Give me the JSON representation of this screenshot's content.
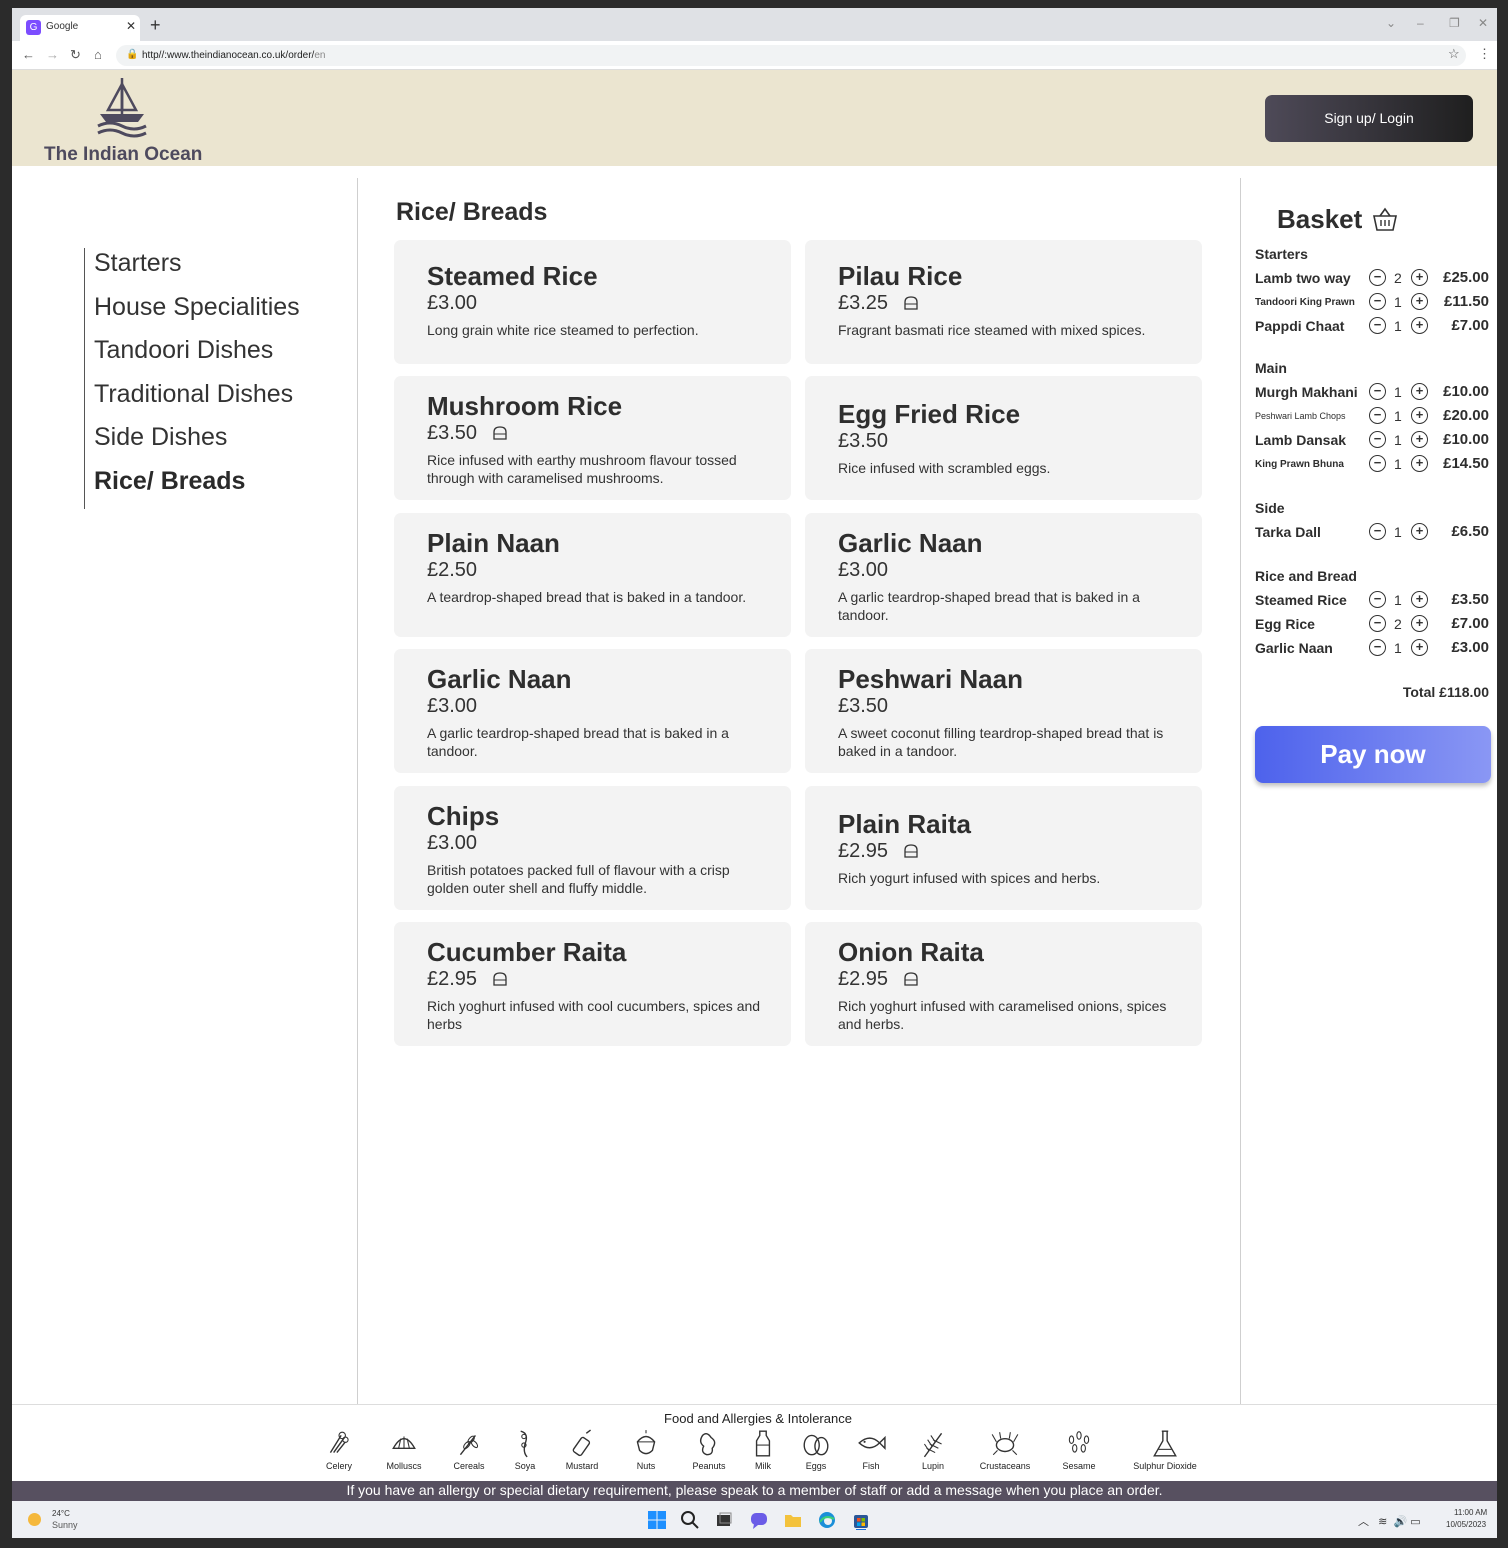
{
  "browser": {
    "tab_title": "Google",
    "url_main": "http//:www.theindianocean.co.uk/order/",
    "url_dim": "en"
  },
  "header": {
    "logo_text": "The Indian Ocean",
    "login_label": "Sign up/ Login"
  },
  "categories": [
    {
      "label": "Starters"
    },
    {
      "label": "House Specialities"
    },
    {
      "label": "Tandoori Dishes"
    },
    {
      "label": "Traditional Dishes"
    },
    {
      "label": "Side Dishes"
    },
    {
      "label": "Rice/ Breads",
      "active": true
    }
  ],
  "section_title": "Rice/ Breads",
  "menu_items": [
    {
      "name": "Steamed Rice",
      "price": "£3.00",
      "desc": "Long grain white rice steamed to perfection.",
      "allergen": false
    },
    {
      "name": "Pilau Rice",
      "price": "£3.25",
      "desc": "Fragrant basmati rice steamed with mixed spices.",
      "allergen": true
    },
    {
      "name": "Mushroom Rice",
      "price": "£3.50",
      "desc": "Rice infused with earthy mushroom flavour tossed through with caramelised mushrooms.",
      "allergen": true
    },
    {
      "name": "Egg Fried Rice",
      "price": "£3.50",
      "desc": "Rice infused with scrambled eggs.",
      "allergen": false
    },
    {
      "name": "Plain Naan",
      "price": "£2.50",
      "desc": "A teardrop-shaped bread that is baked in a tandoor.",
      "allergen": false
    },
    {
      "name": "Garlic Naan",
      "price": "£3.00",
      "desc": "A garlic teardrop-shaped bread that is baked in a tandoor.",
      "allergen": false
    },
    {
      "name": "Garlic Naan",
      "price": "£3.00",
      "desc": "A garlic teardrop-shaped bread that is baked in a tandoor.",
      "allergen": false
    },
    {
      "name": "Peshwari Naan",
      "price": "£3.50",
      "desc": "A sweet coconut filling teardrop-shaped bread that is baked in a tandoor.",
      "allergen": false
    },
    {
      "name": "Chips",
      "price": "£3.00",
      "desc": "British potatoes packed full of flavour with a crisp golden outer shell and fluffy middle.",
      "allergen": false
    },
    {
      "name": "Plain Raita",
      "price": "£2.95",
      "desc": " Rich yogurt infused with spices and herbs.",
      "allergen": true
    },
    {
      "name": "Cucumber Raita",
      "price": "£2.95",
      "desc": "Rich yoghurt infused with cool cucumbers, spices and herbs",
      "allergen": true
    },
    {
      "name": "Onion Raita",
      "price": "£2.95",
      "desc": "Rich yoghurt infused with caramelised onions, spices and herbs.",
      "allergen": true
    }
  ],
  "basket": {
    "title": "Basket",
    "groups": [
      {
        "label": "Starters",
        "items": [
          {
            "name": "Lamb two way",
            "qty": "2",
            "price": "£25.00",
            "size": "normal"
          },
          {
            "name": "Tandoori King Prawn",
            "qty": "1",
            "price": "£11.50",
            "size": "small"
          },
          {
            "name": "Pappdi Chaat",
            "qty": "1",
            "price": "£7.00",
            "size": "normal"
          }
        ]
      },
      {
        "label": "Main",
        "items": [
          {
            "name": "Murgh Makhani",
            "qty": "1",
            "price": "£10.00",
            "size": "normal"
          },
          {
            "name": "Peshwari Lamb Chops",
            "qty": "1",
            "price": "£20.00",
            "size": "tiny"
          },
          {
            "name": "Lamb Dansak",
            "qty": "1",
            "price": "£10.00",
            "size": "normal"
          },
          {
            "name": "King Prawn Bhuna",
            "qty": "1",
            "price": "£14.50",
            "size": "small"
          }
        ]
      },
      {
        "label": "Side",
        "items": [
          {
            "name": "Tarka Dall",
            "qty": "1",
            "price": "£6.50",
            "size": "normal"
          }
        ]
      },
      {
        "label": "Rice and Bread",
        "items": [
          {
            "name": "Steamed Rice",
            "qty": "1",
            "price": "£3.50",
            "size": "normal"
          },
          {
            "name": "Egg Rice",
            "qty": "2",
            "price": "£7.00",
            "size": "normal"
          },
          {
            "name": "Garlic Naan",
            "qty": "1",
            "price": "£3.00",
            "size": "normal"
          }
        ]
      }
    ],
    "total": "Total £118.00",
    "pay_label": "Pay now"
  },
  "allergies": {
    "title": "Food and Allergies & Intolerance",
    "items": [
      "Celery",
      "Molluscs",
      "Cereals",
      "Soya",
      "Mustard",
      "Nuts",
      "Peanuts",
      "Milk",
      "Eggs",
      "Fish",
      "Lupin",
      "Crustaceans",
      "Sesame",
      "Sulphur Dioxide"
    ],
    "notice": "If you have an allergy or special dietary requirement, please speak to a member of staff or add a message when you place an order."
  },
  "taskbar": {
    "temp": "24°C",
    "weather": "Sunny",
    "time": "11:00 AM",
    "date": "10/05/2023"
  },
  "colors": {
    "header_bg": "#ebe5d0",
    "accent": "#4d62ec",
    "notice_bg": "#575060"
  }
}
